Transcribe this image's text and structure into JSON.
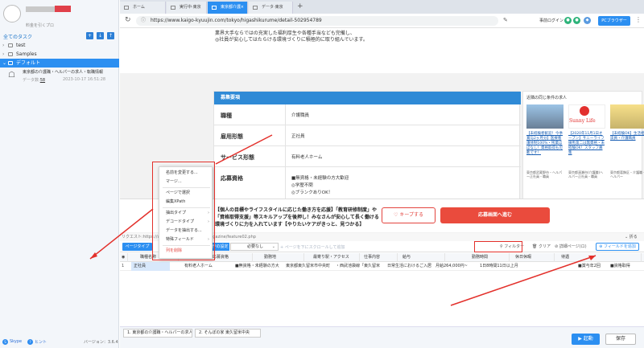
{
  "left_panel": {
    "login_sub": "料金を引くプロ",
    "all_tasks": "全てのタスク",
    "tree": [
      "test",
      "Samples",
      "デフォルト"
    ],
    "task": {
      "title": "東京都の介護職・ヘルパーの求人・転職情報",
      "count_label": "データ数:",
      "count": "58",
      "date": "2023-10-17 16:51:28"
    },
    "footer": {
      "skype": "Skype",
      "hint": "ヒント",
      "version": "バージョン：3.6.4"
    }
  },
  "tabs": [
    "ホーム",
    "実行中·東京",
    "東京都介護",
    "データ·東京"
  ],
  "address": {
    "url": "https://www.kaigo-kyuujin.com/tokyo/higashikurume/detail-502954789",
    "login": "事前ログイン",
    "pc_browser": "PCブラウザー"
  },
  "web": {
    "top_lines": [
      "業界大手ならではの充実した福利厚生や各種手当なども完備し、",
      "◎社員が安心してはたらける環境づくりに積極的に取り組んでいます。"
    ],
    "recruit": {
      "header": "募集要項",
      "rows": [
        {
          "label": "職種",
          "value": "介護職員"
        },
        {
          "label": "雇用形態",
          "value": "正社員"
        },
        {
          "label": "サービス形態",
          "value": "有料老人ホーム"
        },
        {
          "label": "応募資格",
          "value": "■無資格・未経験の方大歓迎"
        }
      ],
      "extra_lines": [
        "◎学歴不問",
        "◎ブランクありOK！"
      ]
    },
    "side": {
      "title": "近隣の同じ条件の求人",
      "jobs": [
        {
          "text": "【未経験者歓迎！今季賞与2ヶ月分】医療看護体制100%・残業ほぼなし！資格取得も可能です！",
          "meta": "東京都武蔵野市・ヘルパー正社員・職員"
        },
        {
          "text": "【2020年11月1日オープン】サニーライフ練馬第二は無資格・未経験OK！スタッフ募集",
          "meta": "東京都清瀬市(介護職)ヘルパー正社員・職員"
        },
        {
          "text": "【未経験OK】生活相談員・介護職員",
          "meta": "東京都葛飾区・介護職・ヘルパー"
        }
      ],
      "sunny": "Sunny Life"
    },
    "cta_lines": [
      "【個人の目標やライフスタイルに応じた働き方を応援】「教育研修制度」や",
      "「資格取得支援」等スキルアップを後押し！みなさんが安心して長く働ける",
      "環境づくりに力を入れています【やりたいケアがきっと、見つかる】"
    ],
    "keep": "キープする",
    "apply": "応募画面へ進む",
    "request_url": "リクエスト:https://www.kaigo-kyuujin.com/magazine/feature02.php",
    "collapse": "折る"
  },
  "context_menu": [
    "名前を変更する...",
    "マージ...",
    "ページで選択",
    "編集XPath",
    "抽出タイプ",
    "デコードタイプ",
    "データを抽出する...",
    "特殊フィールド",
    "列を削除"
  ],
  "data_panel": {
    "page_type": "ページタイプ",
    "setting": "動作の設定",
    "select": "必要なし",
    "scroll": "ページを下にスクロールして追加",
    "filter": "フィルター",
    "clear": "クリア",
    "template": "詳細ページ(ロ)",
    "add_field": "フィールドを追加",
    "headers": [
      "職種名称",
      "応募資格",
      "勤務地",
      "最寄り駅・アクセス",
      "仕事内容",
      "給与",
      "勤務時間",
      "休日休暇",
      "待遇"
    ],
    "row": [
      "正社員",
      "有料老人ホーム",
      "■無資格・未経験の方大",
      "東京都東久留米市中央町",
      "・西武池袋線「東久留米",
      "日常生活におけるご入居",
      "月給264,000円~",
      "1日8時間11日以上月",
      "■賞与年2回",
      "■資格取得"
    ]
  },
  "bottom_tabs": [
    "1. 東京都の介護職・ヘルパーの求人...",
    "2. そんぽの家 東久留米中央"
  ],
  "run": "▶ 起動",
  "save": "保存"
}
